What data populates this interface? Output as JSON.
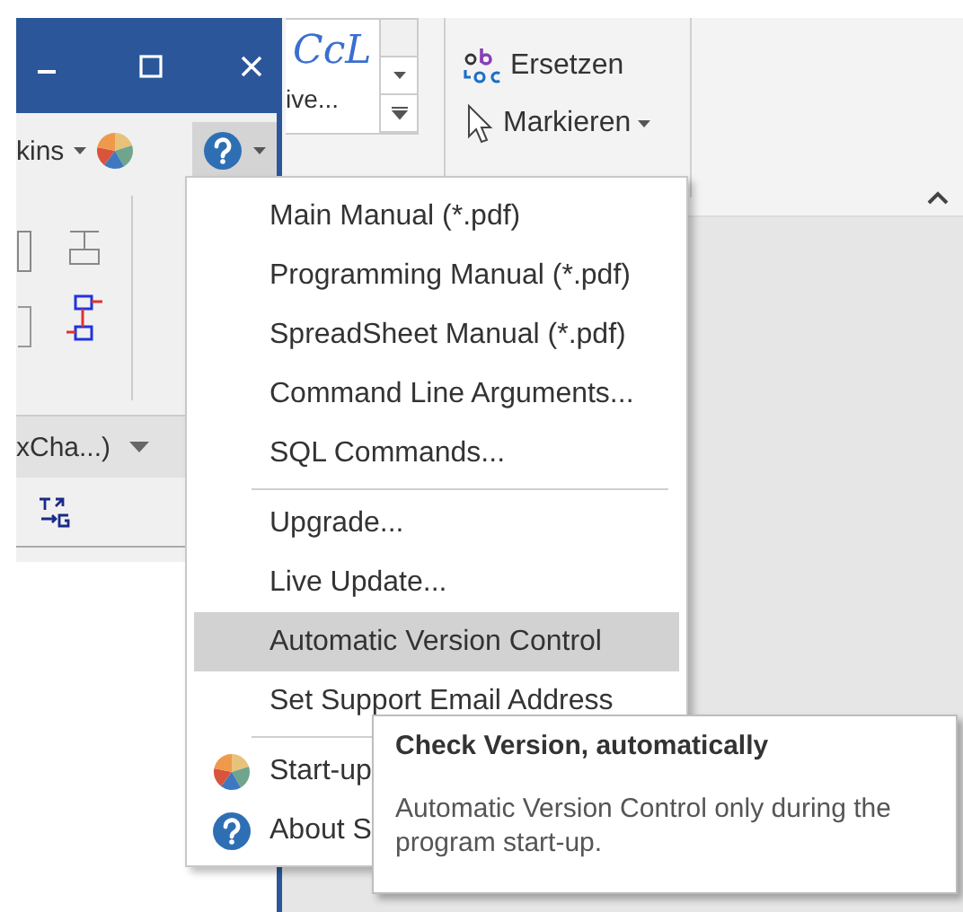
{
  "toolbar": {
    "skins_label": "kins",
    "dropdown_label": "xCha...)"
  },
  "styles_gallery": {
    "preview": "CcL",
    "caption": "ive..."
  },
  "editing": [
    {
      "label": "Ersetzen",
      "kind": "replace"
    },
    {
      "label": "Markieren",
      "kind": "select"
    }
  ],
  "menu": {
    "items": [
      {
        "kind": "command",
        "label": "Main Manual (*.pdf)",
        "selected": false
      },
      {
        "kind": "command",
        "label": "Programming Manual (*.pdf)",
        "selected": false
      },
      {
        "kind": "command",
        "label": "SpreadSheet Manual (*.pdf)",
        "selected": false
      },
      {
        "kind": "command",
        "label": "Command Line Arguments...",
        "selected": false
      },
      {
        "kind": "command",
        "label": "SQL Commands...",
        "selected": false
      },
      {
        "kind": "separator"
      },
      {
        "kind": "command",
        "label": "Upgrade...",
        "selected": false
      },
      {
        "kind": "command",
        "label": "Live Update...",
        "selected": false
      },
      {
        "kind": "command",
        "label": "Automatic Version Control",
        "selected": true
      },
      {
        "kind": "command",
        "label": "Set Support Email Address",
        "selected": false
      },
      {
        "kind": "separator"
      },
      {
        "kind": "startup",
        "label": "Start-up",
        "selected": false
      },
      {
        "kind": "about",
        "label": "About S",
        "selected": false
      }
    ]
  },
  "tooltip": {
    "title": "Check Version, automatically",
    "text": "Automatic Version Control only during the program start-up."
  }
}
